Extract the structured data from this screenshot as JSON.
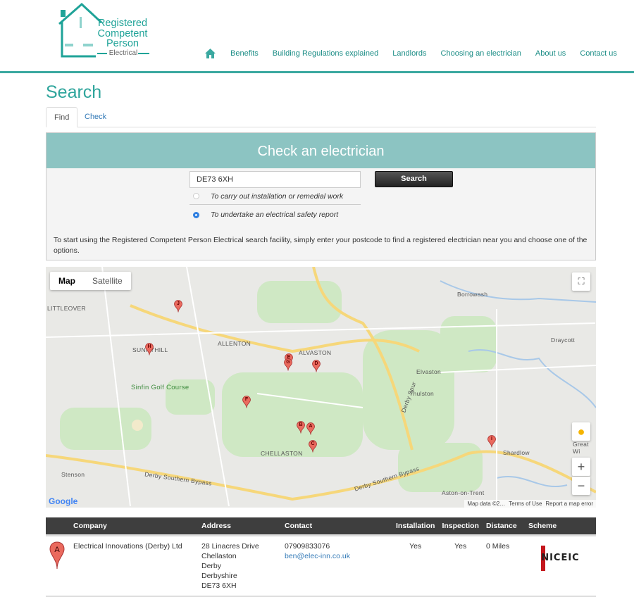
{
  "header": {
    "logo": {
      "line1": "Registered",
      "line2": "Competent",
      "line3": "Person",
      "sub": "Electrical"
    },
    "nav": [
      {
        "label": "Benefits"
      },
      {
        "label": "Building Regulations explained"
      },
      {
        "label": "Landlords"
      },
      {
        "label": "Choosing an electrician"
      },
      {
        "label": "About us"
      },
      {
        "label": "Contact us"
      }
    ],
    "home_icon": "home-icon"
  },
  "page_title": "Search",
  "tabs": [
    {
      "label": "Find",
      "active": true
    },
    {
      "label": "Check",
      "active": false
    }
  ],
  "panel": {
    "title": "Check an electrician",
    "postcode_value": "DE73 6XH",
    "search_label": "Search",
    "options": [
      {
        "label": "To carry out installation or remedial work",
        "selected": false
      },
      {
        "label": "To undertake an electrical safety report",
        "selected": true
      }
    ],
    "intro": "To start using the Registered Competent Person Electrical search facility, simply enter your postcode to find a registered electrician near you and choose one of the options."
  },
  "map": {
    "type_buttons": [
      "Map",
      "Satellite"
    ],
    "labels": [
      "LITTLEOVER",
      "SUNNYHILL",
      "ALLENTON",
      "ALVASTON",
      "Sinfin Golf Course",
      "CHELLASTON",
      "Stenson",
      "Borrowash",
      "Draycott",
      "Elvaston",
      "Thulston",
      "Shardlow",
      "Aston-on-Trent",
      "Derby Southern Bypass",
      "Derby Southern Bypass",
      "Derby Spur",
      "Great Wi"
    ],
    "pins": [
      "J",
      "H",
      "E",
      "G",
      "D",
      "F",
      "B",
      "A",
      "C",
      "I"
    ],
    "google": "Google",
    "footer": [
      "Map data ©2…",
      "Terms of Use",
      "Report a map error"
    ],
    "zoom_in": "+",
    "zoom_out": "−"
  },
  "results": {
    "headers": [
      "",
      "Company",
      "Address",
      "Contact",
      "Installation",
      "Inspection",
      "Distance",
      "Scheme"
    ],
    "rows": [
      {
        "marker": "A",
        "company": "Electrical Innovations (Derby) Ltd",
        "address": [
          "28 Linacres Drive",
          "Chellaston",
          "Derby",
          "Derbyshire",
          "DE73 6XH"
        ],
        "phone": "07909833076",
        "email": "ben@elec-inn.co.uk",
        "installation": "Yes",
        "inspection": "Yes",
        "distance": "0 Miles",
        "scheme": "NICEIC"
      }
    ]
  },
  "colors": {
    "brand": "#2fa59c",
    "panel_header": "#8cc4c2",
    "pin": "#ea6a5e"
  }
}
